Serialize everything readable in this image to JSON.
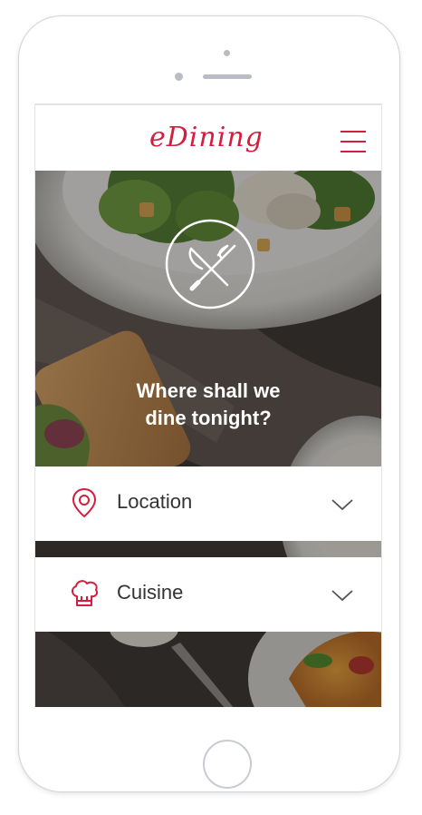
{
  "app": {
    "brand": "eDining",
    "accent_color": "#d31e3e"
  },
  "header": {
    "logo_text": "eDining",
    "menu_icon": "hamburger-menu-icon"
  },
  "hero": {
    "emblem_icon": "fork-knife-icon",
    "title_line1": "Where shall we",
    "title_line2": "dine tonight?"
  },
  "filters": [
    {
      "label": "Location",
      "icon": "map-pin-icon",
      "expand_icon": "chevron-down-icon"
    },
    {
      "label": "Cuisine",
      "icon": "chef-hat-icon",
      "expand_icon": "chevron-down-icon"
    }
  ],
  "device": {
    "frame_color": "#d4d6dc",
    "home_button_icon": "home-button"
  }
}
